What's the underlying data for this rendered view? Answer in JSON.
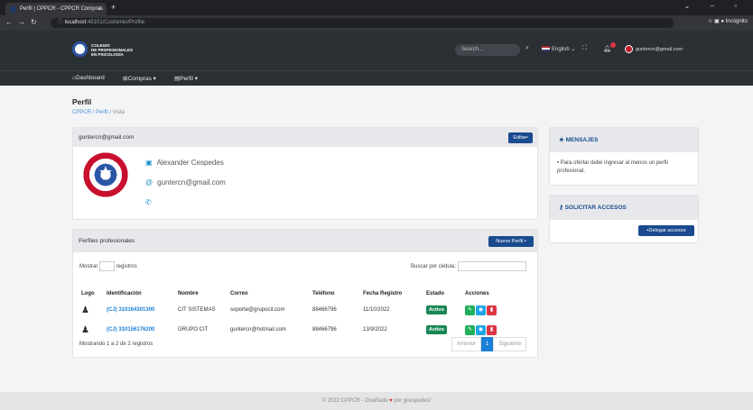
{
  "browser": {
    "tab_title": "Perfil | CPPCR - CPPCR Compras",
    "url_host": "localhost",
    "url_path": ":45101/Customer/Profile",
    "profile_label": "Incógnito"
  },
  "header": {
    "logo_lines": [
      "COLEGIO",
      "DE PROFESIONALES",
      "EN PSICOLOGÍA"
    ],
    "search_placeholder": "Search...",
    "language": "English",
    "user_email": "guntercn@gmail.com",
    "menu": [
      {
        "label": "Dashboard",
        "icon": "home-icon"
      },
      {
        "label": "Compras",
        "icon": "cart-icon"
      },
      {
        "label": "Perfil",
        "icon": "id-icon"
      }
    ]
  },
  "page": {
    "title": "Perfil",
    "breadcrumb": [
      "CPPCR",
      "Perfil",
      "Vista"
    ]
  },
  "profile": {
    "email_header": "guntercn@gmail.com",
    "edit_label": "Editar",
    "name": "Alexander Cespedes",
    "email": "guntercn@gmail.com"
  },
  "perfiles": {
    "title": "Perfiles profesionales",
    "new_label": "Nuevo Perfil",
    "show_label": "Mostrar",
    "records_label": "registros",
    "search_label": "Buscar por cédula:",
    "columns": [
      "Logo",
      "Identificación",
      "Nombre",
      "Correo",
      "Teléfono",
      "Fecha Registro",
      "Estado",
      "Acciones"
    ],
    "rows": [
      {
        "id": "(CJ) 310164301300",
        "nombre": "CIT SISTEMAS",
        "correo": "soporte@grupocit.com",
        "telefono": "88466796",
        "fecha": "11/10/2022",
        "estado": "Activo"
      },
      {
        "id": "(CJ) 310156176200",
        "nombre": "GRUPO CIT",
        "correo": "guntercn@hotmail.com",
        "telefono": "88466796",
        "fecha": "13/9/2022",
        "estado": "Activo"
      }
    ],
    "summary": "Mostrando 1 a 2 de 2 registros",
    "prev": "Anterior",
    "page": "1",
    "next": "Siguiente"
  },
  "mensajes": {
    "title": "MENSAJES",
    "items": [
      "Para ofertar debe ingresar al menos un perfil profesional."
    ]
  },
  "accesos": {
    "title": "SOLICITAR ACCESOS",
    "button": "Delegar accesos"
  },
  "footer": {
    "before": "© 2022 CPPCR - Diseñado",
    "after": "por gcespedes!"
  }
}
